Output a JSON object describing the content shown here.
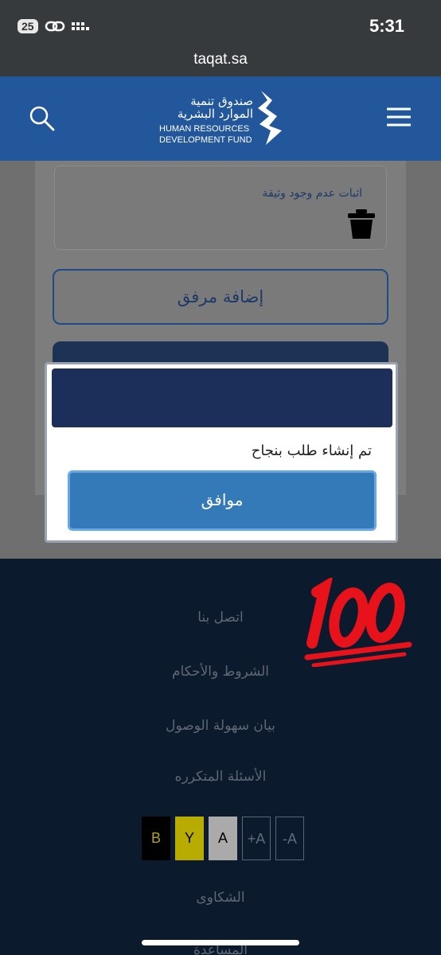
{
  "status_bar": {
    "battery": "25",
    "time": "5:31"
  },
  "browser": {
    "url": "taqat.sa"
  },
  "header": {
    "logo_ar_line1": "صندوق تنمية",
    "logo_ar_line2": "الموارد البشرية",
    "logo_en_line1": "HUMAN RESOURCES",
    "logo_en_line2": "DEVELOPMENT FUND",
    "icons": [
      "search-icon",
      "menu-icon"
    ],
    "color": "#23579b"
  },
  "page": {
    "document_label": "اثبات عدم وجود وثيقة",
    "add_attachment_label": "إضافة مرفق"
  },
  "modal": {
    "message": "تم إنشاء طلب بنجاح",
    "ok_label": "موافق",
    "header_color": "#1c2f5b",
    "button_color": "#357ab8"
  },
  "footer": {
    "links": [
      "اتصل بنا",
      "الشروط والأحكام",
      "بيان سهولة الوصول",
      "الأسئلة المتكرره",
      "الشكاوى",
      "المساعدة"
    ],
    "accessibility": {
      "b": "B",
      "y": "Y",
      "a": "A",
      "plus": "+A",
      "minus": "-A"
    }
  }
}
